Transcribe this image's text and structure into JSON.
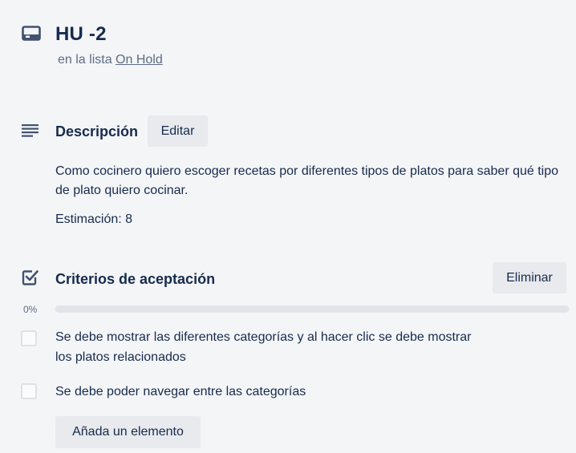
{
  "card": {
    "icon": "card-icon",
    "title": "HU -2",
    "list_prefix": "en la lista",
    "list_name": "On Hold"
  },
  "description": {
    "icon": "description-icon",
    "title": "Descripción",
    "edit_label": "Editar",
    "text": "Como cocinero quiero escoger recetas por diferentes tipos de platos para saber qué tipo de plato quiero cocinar.",
    "estimate": "Estimación: 8"
  },
  "checklist": {
    "icon": "checkbox-checked-icon",
    "title": "Criterios de aceptación",
    "delete_label": "Eliminar",
    "progress_label": "0%",
    "progress": 0,
    "items": [
      {
        "text": "Se debe mostrar las diferentes categorías y al hacer clic se debe mostrar los platos relacionados",
        "checked": false
      },
      {
        "text": "Se debe poder navegar entre las categorías",
        "checked": false
      }
    ],
    "add_label": "Añada un elemento"
  },
  "colors": {
    "background": "#f4f5f7",
    "text": "#172b4d",
    "muted": "#5e6c84",
    "button": "#e8eaed",
    "progress_track": "#e1e4e9"
  }
}
